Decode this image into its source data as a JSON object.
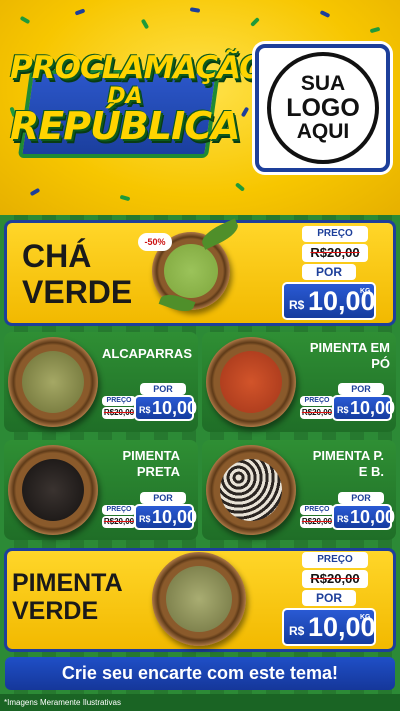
{
  "header": {
    "title_line1": "PROCLAMAÇÃO",
    "title_line2": "DA",
    "title_line3": "REPÚBLICA",
    "logo": {
      "line1": "SUA",
      "line2": "LOGO",
      "line3": "AQUI"
    }
  },
  "featured_top": {
    "name_line1": "CHÁ",
    "name_line2": "VERDE",
    "discount": "-50%",
    "preco_label": "PREÇO",
    "old_price": "R$20,00",
    "por_label": "POR",
    "currency": "R$",
    "price": "10,00",
    "unit": "KG"
  },
  "products": [
    {
      "name_line1": "ALCAPARRAS",
      "name_line2": "",
      "preco_label": "PREÇO",
      "old_price": "R$20,00",
      "por_label": "POR",
      "currency": "R$",
      "price": "10,00"
    },
    {
      "name_line1": "PIMENTA EM",
      "name_line2": "PÓ",
      "preco_label": "PREÇO",
      "old_price": "R$20,00",
      "por_label": "POR",
      "currency": "R$",
      "price": "10,00"
    },
    {
      "name_line1": "PIMENTA",
      "name_line2": "PRETA",
      "preco_label": "PREÇO",
      "old_price": "R$20,00",
      "por_label": "POR",
      "currency": "R$",
      "price": "10,00"
    },
    {
      "name_line1": "PIMENTA P.",
      "name_line2": "E B.",
      "preco_label": "PREÇO",
      "old_price": "R$20,00",
      "por_label": "POR",
      "currency": "R$",
      "price": "10,00"
    }
  ],
  "featured_bottom": {
    "name_line1": "PIMENTA",
    "name_line2": "VERDE",
    "preco_label": "PREÇO",
    "old_price": "R$20,00",
    "por_label": "POR",
    "currency": "R$",
    "price": "10,00",
    "unit": "KG"
  },
  "cta": "Crie seu encarte com este tema!",
  "footer": "*Imagens Meramente Ilustrativas",
  "colors": {
    "yellow": "#f7c600",
    "blue": "#1d3f9a",
    "green": "#2c8a36"
  }
}
